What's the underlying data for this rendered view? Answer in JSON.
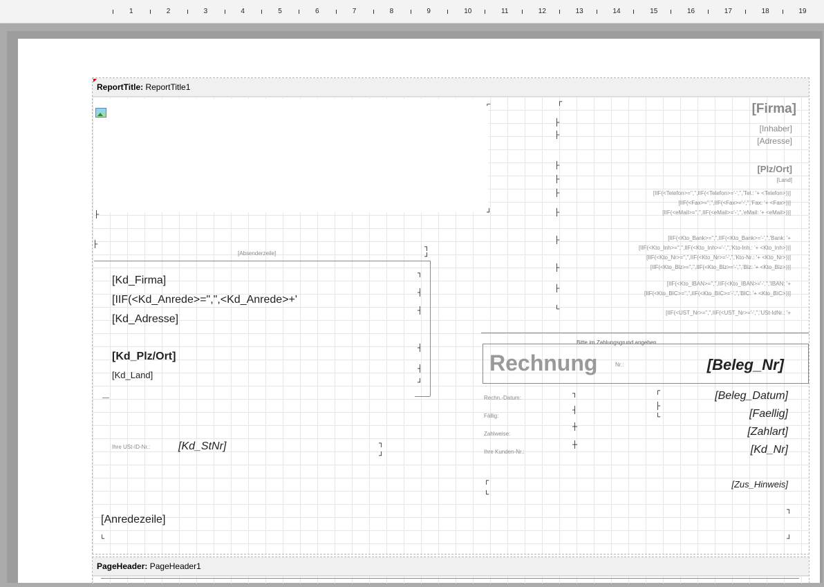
{
  "ruler": {
    "numbers": [
      "1",
      "2",
      "3",
      "4",
      "5",
      "6",
      "7",
      "8",
      "9",
      "10",
      "11",
      "12",
      "13",
      "14",
      "15",
      "16",
      "17",
      "18",
      "19"
    ]
  },
  "report_title_band": {
    "label": "ReportTitle:",
    "name": "ReportTitle1",
    "sender_line": "[Absenderzeile]",
    "customer": {
      "firma": "[Kd_Firma]",
      "anrede": "[IIF(<Kd_Anrede>=\",\",<Kd_Anrede>+'",
      "adresse": "[Kd_Adresse]",
      "plz_ort": "[Kd_Plz/Ort]",
      "land": "[Kd_Land]"
    },
    "ust_label": "Ihre USt-ID-Nr.:",
    "ust_value": "[Kd_StNr]",
    "anredezeile": "[Anredezeile]",
    "company": {
      "firma": "[Firma]",
      "inhaber": "[Inhaber]",
      "adresse": "[Adresse]",
      "plz_ort": "[Plz/Ort]",
      "land": "[Land]",
      "contact": [
        "[IIF(<Telefon>='','',IIF(<Telefon>='-','','Tel.: '+ <Telefon>))]",
        "[IIF(<Fax>='','',IIF(<Fax>='-','','Fax: '+ <Fax>))]",
        "[IIF(<eMail>='','',IIF(<eMail>='-','','eMail: '+ <eMail>))]"
      ],
      "bank": [
        "[IIF(<Kto_Bank>='','',IIF(<Kto_Bank>='-','','Bank: '+",
        "[IIF(<Kto_Inh>='','',IIF(<Kto_Inh>='-','','Kto-Inh.: '+ <Kto_Inh>))]",
        "[IIF(<Kto_Nr>='','',IIF(<Kto_Nr>='-','','Kto-Nr.: '+ <Kto_Nr>))]",
        "[IIF(<Kto_Blz>='','',IIF(<Kto_Blz>='-','','Blz: '+ <Kto_Blz>))]",
        "[IIF(<Kto_IBAN>='','',IIF(<Kto_IBAN>='-','','IBAN: '+",
        "[IIF(<Kto_BIC>='','',IIF(<Kto_BIC>='-','','BIC: '+ <Kto_BIC>))]"
      ],
      "ust": "[IIF(<UST_Nr>='','',IIF(<UST_Nr>='-','','USt-IdNr.: '+"
    },
    "invoice": {
      "hint": "Bitte im Zahlungsgrund angeben",
      "title": "Rechnung",
      "nr_label": "Nr.:",
      "beleg_nr": "[Beleg_Nr]",
      "rows": [
        {
          "label": "Rechn.-Datum:",
          "value": "[Beleg_Datum]"
        },
        {
          "label": "Fällig:",
          "value": "[Faellig]"
        },
        {
          "label": "Zahlweise:",
          "value": "[Zahlart]"
        },
        {
          "label": "Ihre Kunden-Nr.:",
          "value": "[Kd_Nr]"
        }
      ],
      "zus_hinweis": "[Zus_Hinweis]"
    }
  },
  "page_header_band": {
    "label": "PageHeader:",
    "name": "PageHeader1"
  }
}
